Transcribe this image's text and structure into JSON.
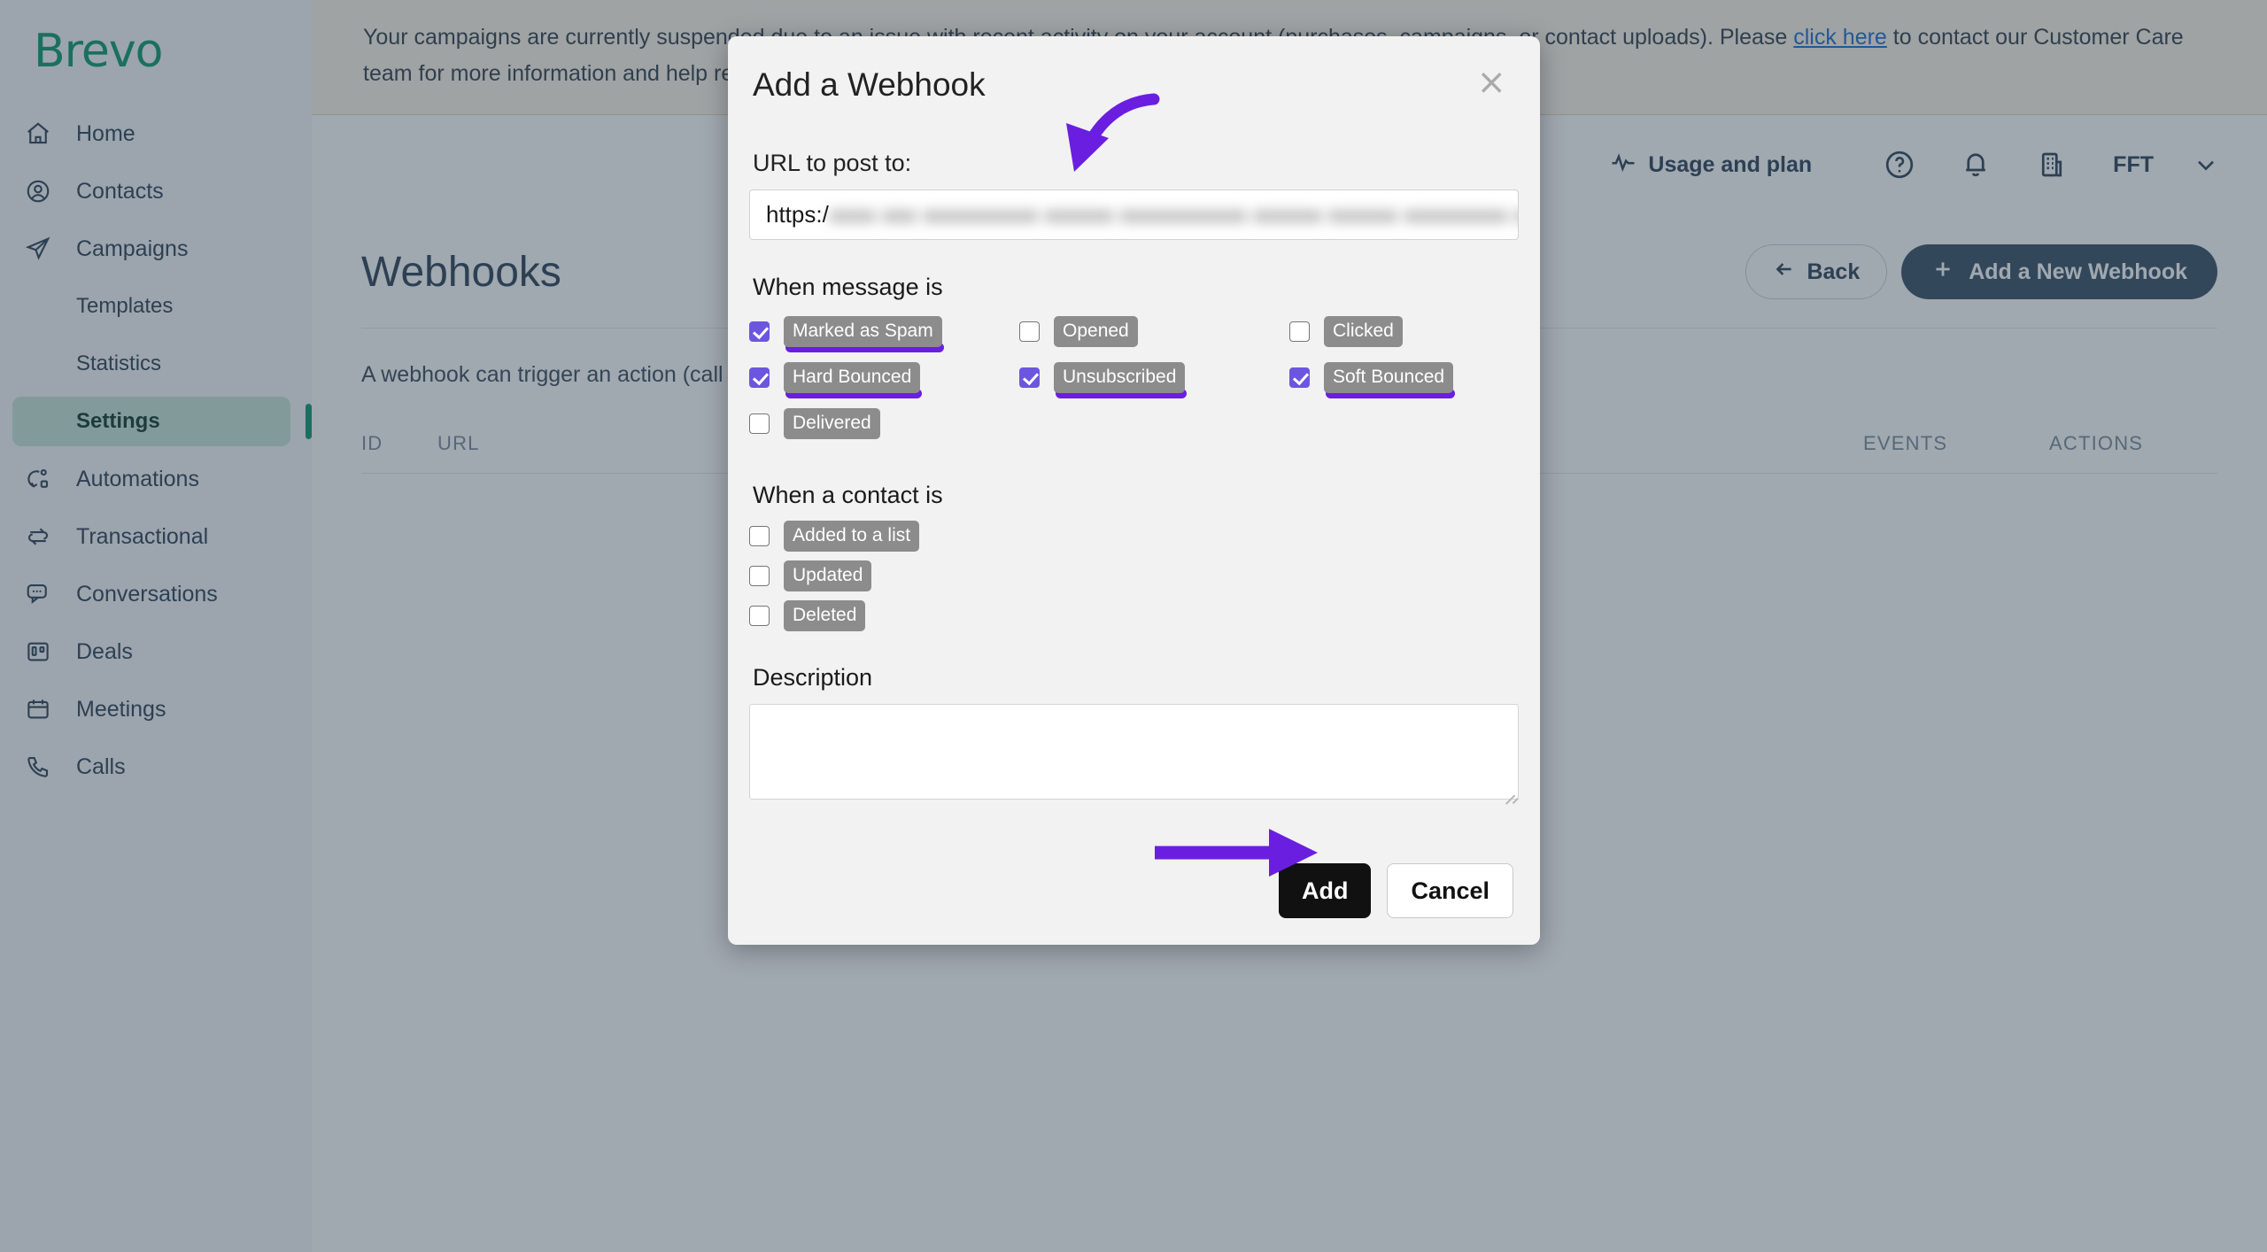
{
  "brand": {
    "name": "Brevo",
    "color": "#0b996e"
  },
  "sidebar": {
    "items": [
      {
        "label": "Home",
        "icon": "home-icon",
        "sub": false,
        "active": false
      },
      {
        "label": "Contacts",
        "icon": "contacts-icon",
        "sub": false,
        "active": false
      },
      {
        "label": "Campaigns",
        "icon": "campaigns-icon",
        "sub": false,
        "active": false
      },
      {
        "label": "Templates",
        "icon": "",
        "sub": true,
        "active": false
      },
      {
        "label": "Statistics",
        "icon": "",
        "sub": true,
        "active": false
      },
      {
        "label": "Settings",
        "icon": "",
        "sub": true,
        "active": true
      },
      {
        "label": "Automations",
        "icon": "automations-icon",
        "sub": false,
        "active": false
      },
      {
        "label": "Transactional",
        "icon": "transactional-icon",
        "sub": false,
        "active": false
      },
      {
        "label": "Conversations",
        "icon": "conversations-icon",
        "sub": false,
        "active": false
      },
      {
        "label": "Deals",
        "icon": "deals-icon",
        "sub": false,
        "active": false
      },
      {
        "label": "Meetings",
        "icon": "meetings-icon",
        "sub": false,
        "active": false
      },
      {
        "label": "Calls",
        "icon": "calls-icon",
        "sub": false,
        "active": false
      }
    ]
  },
  "banner": {
    "before_link": "Your campaigns are currently suspended due to an issue with recent activity on your account (purchases, campaigns, or contact uploads). Please ",
    "link_text": "click here",
    "after_link": " to contact our Customer Care team for more information and help reactivating your account."
  },
  "topbar": {
    "usage_label": "Usage and plan",
    "account_label": "FFT",
    "icons": [
      "pulse-icon",
      "help-circle-icon",
      "bell-icon",
      "building-icon",
      "chevron-down-icon"
    ]
  },
  "page": {
    "title": "Webhooks",
    "back_label": "Back",
    "add_new_label": "Add a New Webhook",
    "description": "A webhook can trigger an action (call a URL) when a specific event occurs.",
    "table_headers": {
      "id": "ID",
      "url": "URL",
      "events": "EVENTS",
      "actions": "ACTIONS"
    }
  },
  "modal": {
    "title": "Add a Webhook",
    "close_label": "×",
    "url_label": "URL to post to:",
    "url_prefix": "https:/",
    "url_value_redacted": "xxxx xxx xxxxxxxxxx xxxxxx xxxxxxxxxxx xxxxxx xxxxxx xxxxxxxxx xxxx",
    "message_section_title": "When message is",
    "message_events": [
      {
        "label": "Marked as Spam",
        "checked": true,
        "highlighted": true
      },
      {
        "label": "Opened",
        "checked": false,
        "highlighted": false
      },
      {
        "label": "Clicked",
        "checked": false,
        "highlighted": false
      },
      {
        "label": "Hard Bounced",
        "checked": true,
        "highlighted": true
      },
      {
        "label": "Unsubscribed",
        "checked": true,
        "highlighted": true
      },
      {
        "label": "Soft Bounced",
        "checked": true,
        "highlighted": true
      },
      {
        "label": "Delivered",
        "checked": false,
        "highlighted": false
      }
    ],
    "contact_section_title": "When a contact is",
    "contact_events": [
      {
        "label": "Added to a list",
        "checked": false,
        "highlighted": false
      },
      {
        "label": "Updated",
        "checked": false,
        "highlighted": false
      },
      {
        "label": "Deleted",
        "checked": false,
        "highlighted": false
      }
    ],
    "description_label": "Description",
    "description_value": "",
    "add_label": "Add",
    "cancel_label": "Cancel"
  },
  "annotations": {
    "accent_color": "#6a1fe0",
    "curved_arrow_target": "url-input",
    "straight_arrow_target": "add-button"
  }
}
